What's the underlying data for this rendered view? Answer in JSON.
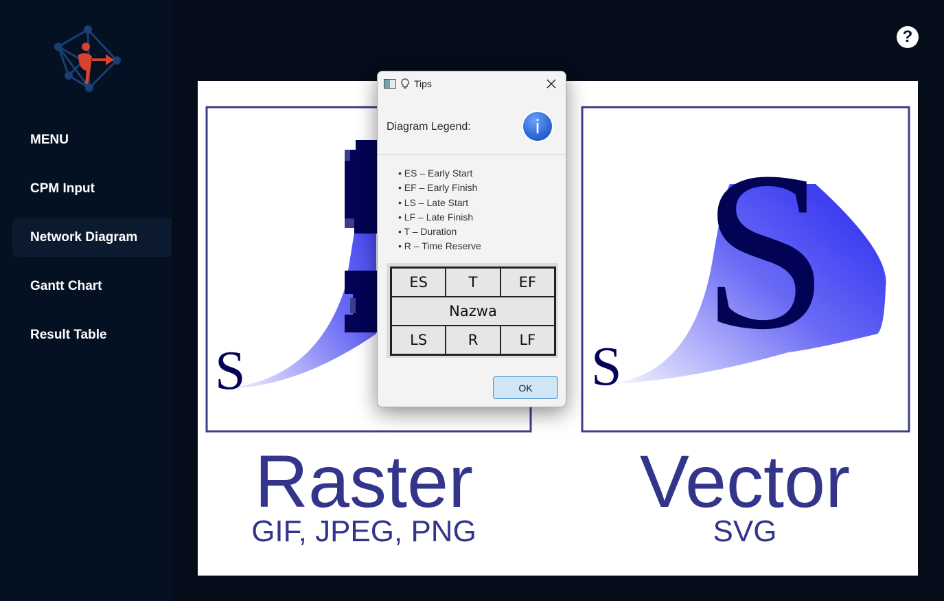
{
  "sidebar": {
    "items": [
      {
        "label": "MENU"
      },
      {
        "label": "CPM Input"
      },
      {
        "label": "Network Diagram"
      },
      {
        "label": "Gantt Chart"
      },
      {
        "label": "Result Table"
      }
    ],
    "active_index": 2
  },
  "help": {
    "label": "?"
  },
  "image": {
    "raster_letter_small": "S",
    "vector_letter_big": "S",
    "vector_letter_small": "S",
    "raster_title": "Raster",
    "raster_sub": "GIF, JPEG, PNG",
    "vector_title": "Vector",
    "vector_sub": "SVG"
  },
  "dialog": {
    "title": "Tips",
    "legend_title": "Diagram Legend:",
    "info_glyph": "i",
    "bullets": [
      "ES – Early Start",
      "EF – Early Finish",
      "LS – Late Start",
      "LF – Late Finish",
      "T – Duration",
      "R – Time Reserve"
    ],
    "grid": {
      "row1": [
        "ES",
        "T",
        "EF"
      ],
      "row2": "Nazwa",
      "row3": [
        "LS",
        "R",
        "LF"
      ]
    },
    "ok_label": "OK"
  },
  "colors": {
    "background": "#050d1a",
    "sidebar": "#041122",
    "accent_red": "#d9432e",
    "graphic_blue": "#33358a",
    "letter_navy": "#030356"
  }
}
